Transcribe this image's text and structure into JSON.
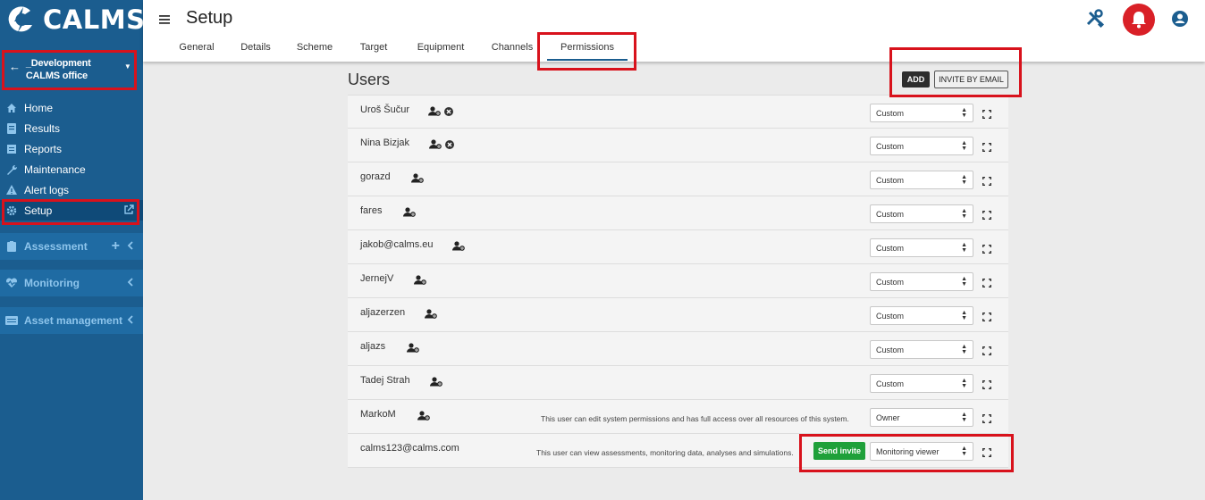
{
  "sidebar": {
    "logo_text": "CALMS",
    "org_name": "_Development CALMS office",
    "nav": [
      {
        "label": "Home",
        "icon": "home-icon"
      },
      {
        "label": "Results",
        "icon": "results-icon"
      },
      {
        "label": "Reports",
        "icon": "reports-icon"
      },
      {
        "label": "Maintenance",
        "icon": "wrench-icon"
      },
      {
        "label": "Alert logs",
        "icon": "alert-icon"
      },
      {
        "label": "Setup",
        "icon": "gear-icon"
      }
    ],
    "sections": [
      {
        "label": "Assessment",
        "icon": "clipboard-icon"
      },
      {
        "label": "Monitoring",
        "icon": "heartbeat-icon"
      },
      {
        "label": "Asset management",
        "icon": "asset-icon"
      }
    ]
  },
  "header": {
    "title": "Setup",
    "tabs": [
      "General",
      "Details",
      "Scheme",
      "Target",
      "Equipment",
      "Channels",
      "Permissions"
    ],
    "active_tab": "Permissions"
  },
  "users_panel": {
    "title": "Users",
    "add_label": "ADD",
    "invite_label": "INVITE BY EMAIL",
    "send_invite_label": "Send invite",
    "users": [
      {
        "name": "Uroš Šučur",
        "role": "Custom",
        "desc": "",
        "removable": true
      },
      {
        "name": "Nina Bizjak",
        "role": "Custom",
        "desc": "",
        "removable": true
      },
      {
        "name": "gorazd",
        "role": "Custom",
        "desc": ""
      },
      {
        "name": "fares",
        "role": "Custom",
        "desc": ""
      },
      {
        "name": "jakob@calms.eu",
        "role": "Custom",
        "desc": ""
      },
      {
        "name": "JernejV",
        "role": "Custom",
        "desc": ""
      },
      {
        "name": "aljazerzen",
        "role": "Custom",
        "desc": ""
      },
      {
        "name": "aljazs",
        "role": "Custom",
        "desc": ""
      },
      {
        "name": "Tadej Strah",
        "role": "Custom",
        "desc": ""
      },
      {
        "name": "MarkoM",
        "role": "Owner",
        "desc": "This user can edit system permissions and has full access over all resources of this system."
      },
      {
        "name": "calms123@calms.com",
        "role": "Monitoring viewer",
        "desc": "This user can view assessments, monitoring data, analyses and simulations.",
        "pending": true
      }
    ]
  },
  "colors": {
    "sidebar": "#1b5d8f",
    "accent_red": "#d8121c",
    "send_green": "#1fa03a"
  }
}
